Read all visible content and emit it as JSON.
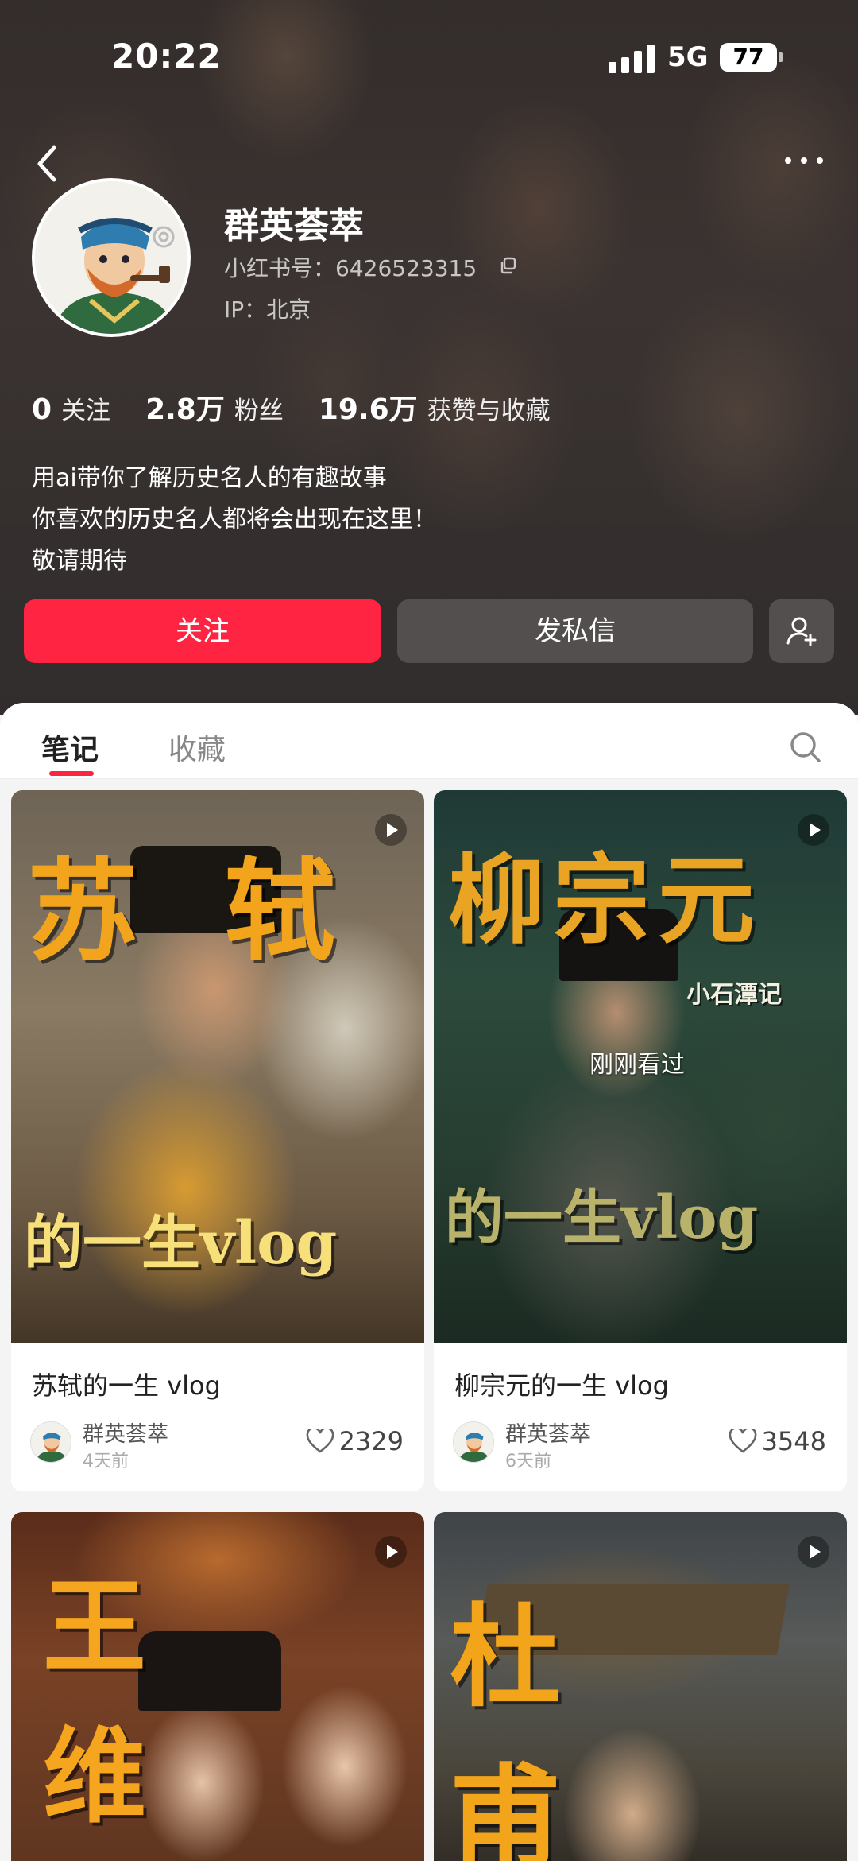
{
  "status_bar": {
    "time": "20:22",
    "network": "5G",
    "battery": "77"
  },
  "profile": {
    "nickname": "群英荟萃",
    "red_id": "小红书号：6426523315",
    "ip": "IP：北京",
    "stats": [
      {
        "value": "0",
        "label": "关注"
      },
      {
        "value": "2.8万",
        "label": "粉丝"
      },
      {
        "value": "19.6万",
        "label": "获赞与收藏"
      }
    ],
    "bio": [
      "用ai带你了解历史名人的有趣故事",
      "你喜欢的历史名人都将会出现在这里！",
      "敬请期待"
    ]
  },
  "actions": {
    "follow_label": "关注",
    "message_label": "发私信",
    "add_friend_icon": "add-user-icon"
  },
  "tabs": [
    {
      "label": "笔记",
      "active": true
    },
    {
      "label": "收藏",
      "active": false
    }
  ],
  "notes": [
    {
      "cover_title": "苏 轼",
      "cover_vlog": "的一生vlog",
      "title": "苏轼的一生 vlog",
      "author": "群英荟萃",
      "time": "4天前",
      "likes": "2329"
    },
    {
      "cover_title": "柳宗元",
      "cover_sub": "小石潭记",
      "cover_vlog": "的一生vlog",
      "badge": "刚刚看过",
      "title": "柳宗元的一生 vlog",
      "author": "群英荟萃",
      "time": "6天前",
      "likes": "3548"
    },
    {
      "cover_title": "王 维"
    },
    {
      "cover_title": "杜 甫"
    }
  ],
  "colors": {
    "accent": "#ff2442",
    "cover_title": "#f2a51c"
  }
}
